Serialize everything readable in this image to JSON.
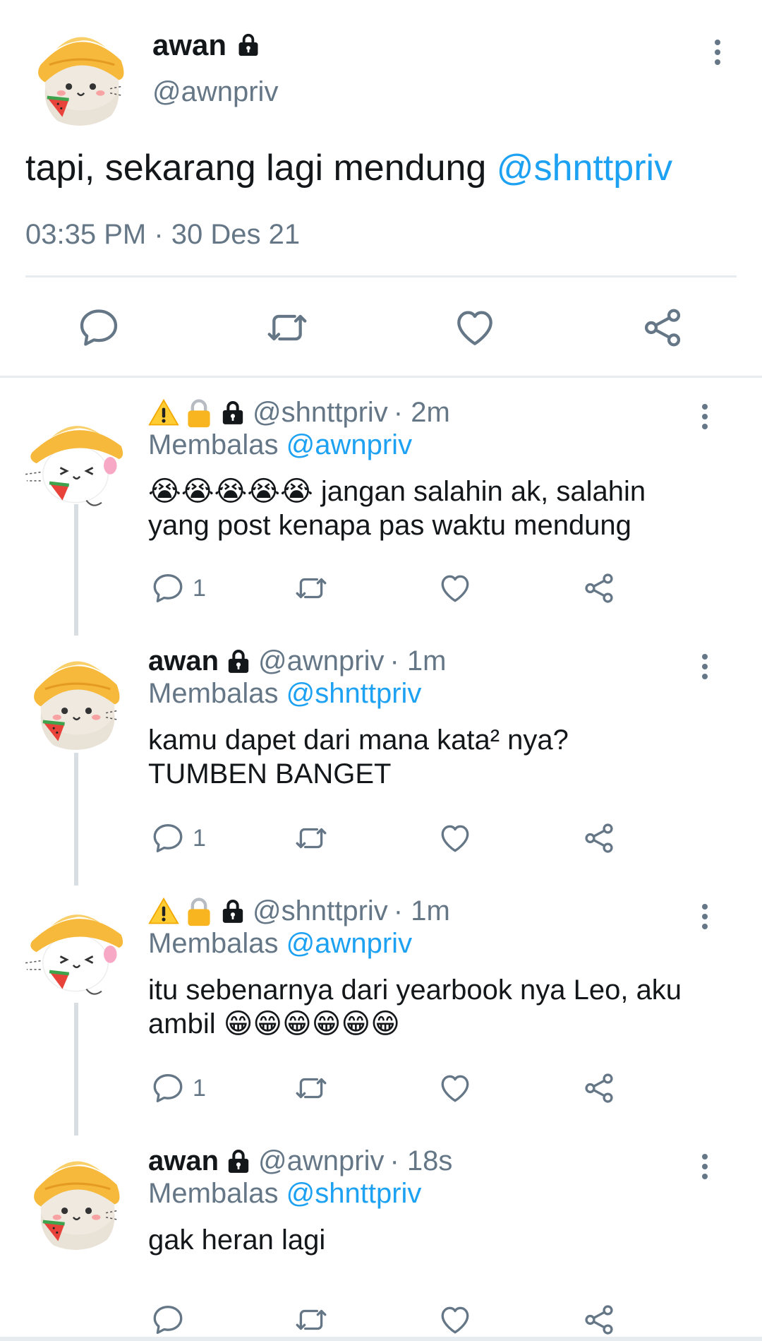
{
  "main_tweet": {
    "name": "awan",
    "handle": "@awnpriv",
    "text": "tapi, sekarang lagi mendung ",
    "mention": "@shnttpriv",
    "timestamp": "03:35 PM · 30 Des 21"
  },
  "replies": [
    {
      "name": "",
      "handle": "@shnttpriv",
      "time": "· 2m",
      "replying_label": "Membalas ",
      "replying_to": "@awnpriv",
      "emoji_prefix": "😭😭😭😭😭",
      "text_line1": " jangan salahin ak, salahin",
      "text_line2": "yang post kenapa pas waktu mendung",
      "reply_count": "1"
    },
    {
      "name": "awan",
      "handle": "@awnpriv",
      "time": "· 1m",
      "replying_label": "Membalas ",
      "replying_to": "@shnttpriv",
      "text_line1": "kamu dapet dari mana kata² nya?",
      "text_line2": "TUMBEN BANGET",
      "reply_count": "1"
    },
    {
      "name": "",
      "handle": "@shnttpriv",
      "time": "· 1m",
      "replying_label": "Membalas ",
      "replying_to": "@awnpriv",
      "text_line1": "itu sebenarnya dari yearbook nya Leo, aku",
      "text_line2": "ambil ",
      "emoji_suffix": "😁😁😁😁😁😁",
      "reply_count": "1"
    },
    {
      "name": "awan",
      "handle": "@awnpriv",
      "time": "· 18s",
      "replying_label": "Membalas ",
      "replying_to": "@shnttpriv",
      "text_line1": "gak heran lagi",
      "reply_count": ""
    }
  ],
  "colors": {
    "text": "#14171a",
    "secondary": "#657786",
    "link": "#1da1f2",
    "divider": "#e6ecf0",
    "thread": "#d9dee2"
  },
  "icons": {
    "reply": "comment-icon",
    "retweet": "retweet-icon",
    "like": "heart-icon",
    "share": "share-icon",
    "more": "more-vertical-icon",
    "lock": "lock-icon",
    "warning": "warning-icon",
    "padlock": "padlock-icon"
  }
}
